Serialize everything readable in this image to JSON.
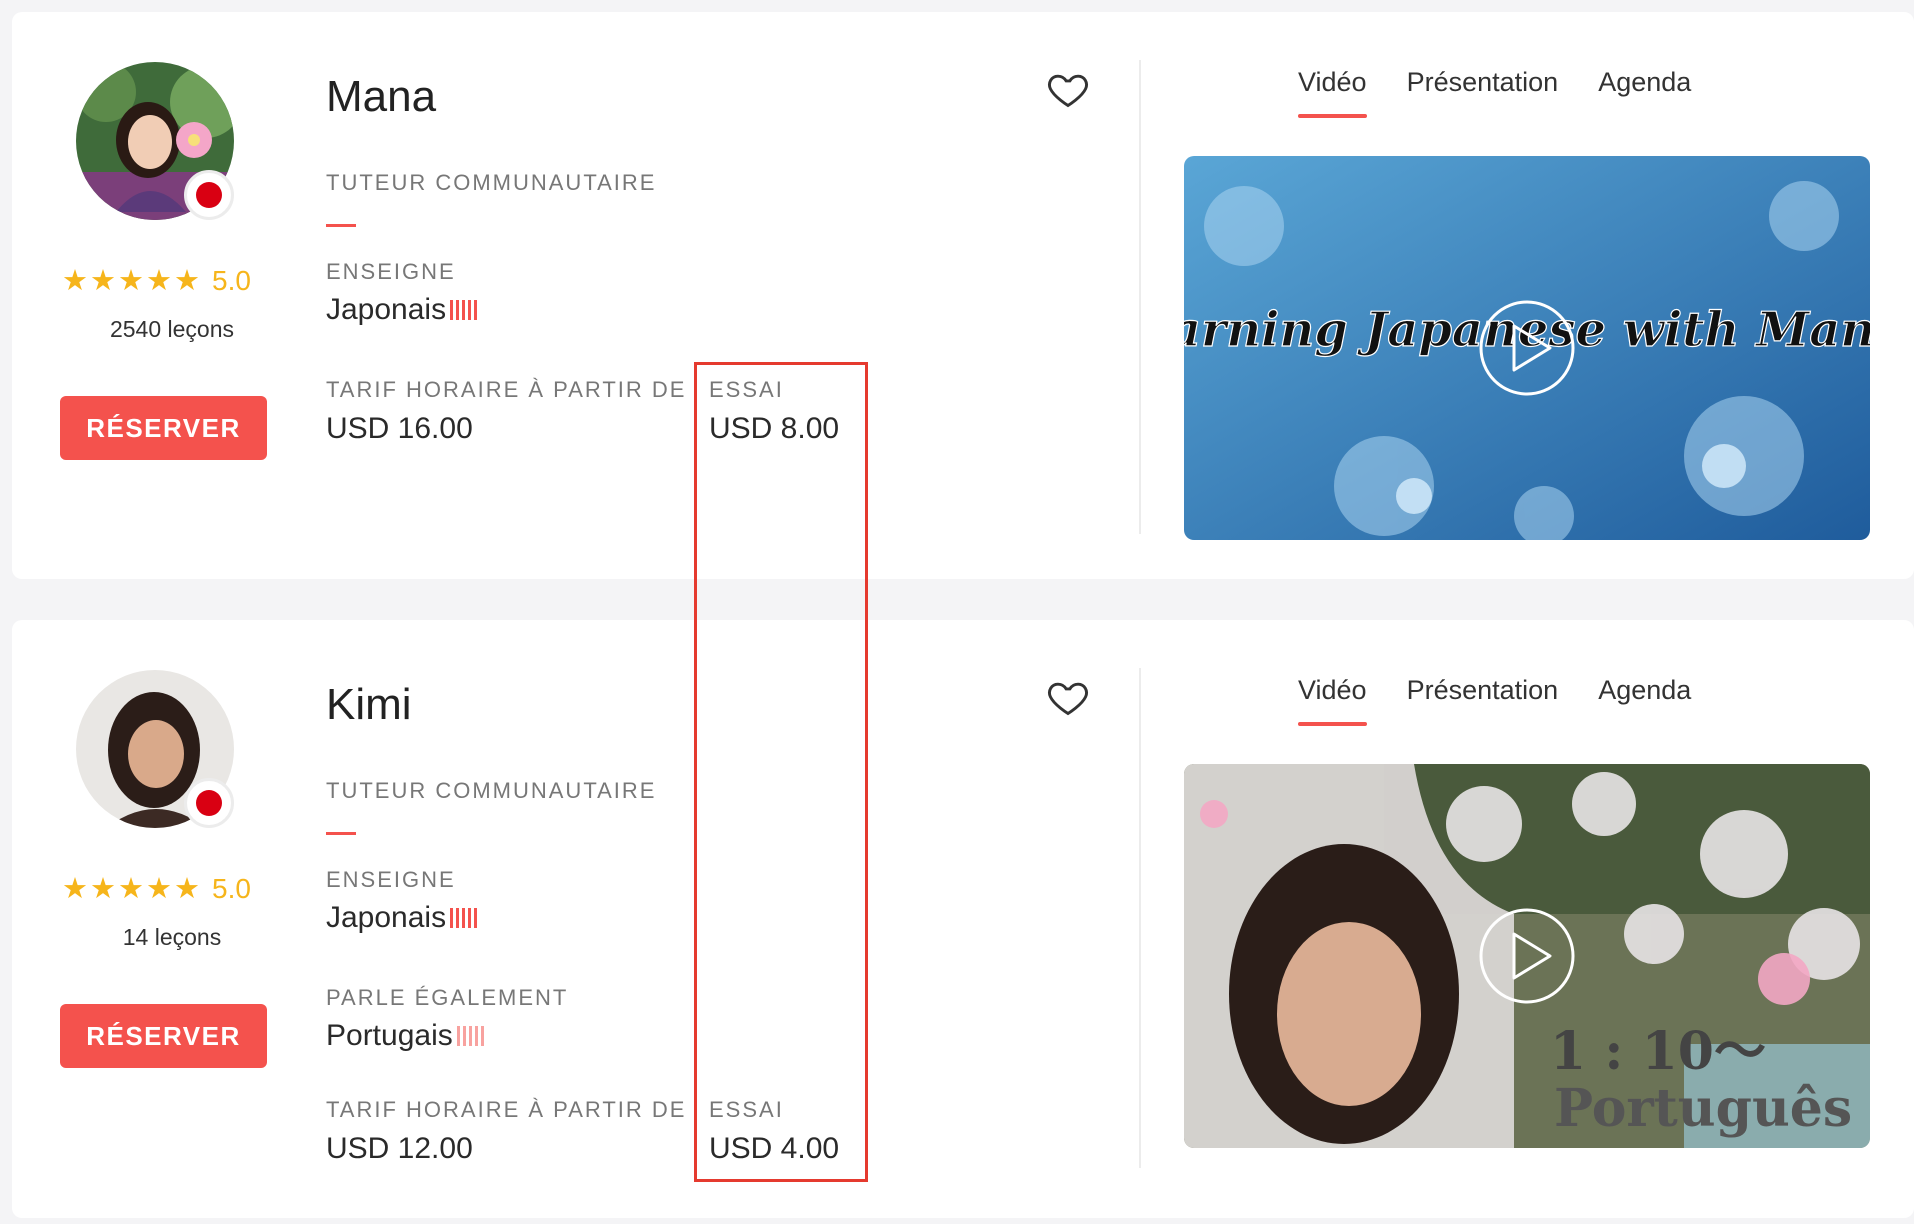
{
  "tutors": [
    {
      "name": "Mana",
      "category": "TUTEUR COMMUNAUTAIRE",
      "rating": "5.0",
      "lessons": "2540 leçons",
      "reserve_label": "RÉSERVER",
      "teaches_label": "ENSEIGNE",
      "teaches": "Japonais",
      "rate_label": "TARIF HORAIRE À PARTIR DE",
      "rate": "USD 16.00",
      "trial_label": "ESSAI",
      "trial": "USD 8.00",
      "tabs": [
        "Vidéo",
        "Présentation",
        "Agenda"
      ],
      "video_caption": "Learning Japanese with Mana!!"
    },
    {
      "name": "Kimi",
      "category": "TUTEUR COMMUNAUTAIRE",
      "rating": "5.0",
      "lessons": "14 leçons",
      "reserve_label": "RÉSERVER",
      "teaches_label": "ENSEIGNE",
      "teaches": "Japonais",
      "also_label": "PARLE ÉGALEMENT",
      "also": "Portugais",
      "rate_label": "TARIF HORAIRE À PARTIR DE",
      "rate": "USD 12.00",
      "trial_label": "ESSAI",
      "trial": "USD 4.00",
      "tabs": [
        "Vidéo",
        "Présentation",
        "Agenda"
      ],
      "video_caption_line1": "1 : 10〜",
      "video_caption_line2": "Português"
    }
  ],
  "colors": {
    "accent": "#f4524d",
    "star": "#f6b51b",
    "highlight_border": "#e53a2f",
    "flag_red": "#d90012"
  }
}
